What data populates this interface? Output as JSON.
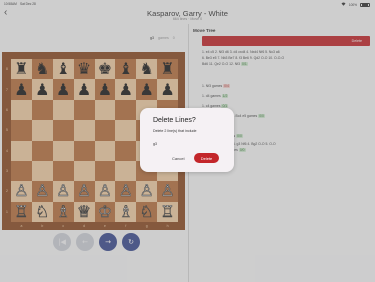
{
  "status_bar": {
    "time": "10:58AM",
    "date": "Sat Dec 28",
    "wifi": "wifi-icon",
    "battery_percent": "100%"
  },
  "header": {
    "title": "Kasparov, Garry - White",
    "subtitle": "664 lines · Move 0"
  },
  "left_toolbar": {
    "move": "g3",
    "games_label": "games",
    "games_count": "0"
  },
  "board": {
    "ranks": [
      "8",
      "7",
      "6",
      "5",
      "4",
      "3",
      "2",
      "1"
    ],
    "files": [
      "a",
      "b",
      "c",
      "d",
      "e",
      "f",
      "g",
      "h"
    ],
    "pieces": [
      [
        "♜",
        "♞",
        "♝",
        "♛",
        "♚",
        "♝",
        "♞",
        "♜"
      ],
      [
        "♟",
        "♟",
        "♟",
        "♟",
        "♟",
        "♟",
        "♟",
        "♟"
      ],
      [
        "",
        "",
        "",
        "",
        "",
        "",
        "",
        ""
      ],
      [
        "",
        "",
        "",
        "",
        "",
        "",
        "",
        ""
      ],
      [
        "",
        "",
        "",
        "",
        "",
        "",
        "",
        ""
      ],
      [
        "",
        "",
        "",
        "",
        "",
        "",
        "",
        ""
      ],
      [
        "♙",
        "♙",
        "♙",
        "♙",
        "♙",
        "♙",
        "♙",
        "♙"
      ],
      [
        "♖",
        "♘",
        "♗",
        "♕",
        "♔",
        "♗",
        "♘",
        "♖"
      ]
    ]
  },
  "nav": {
    "first": "|◀",
    "prev": "←",
    "next": "→",
    "flip": "↻"
  },
  "move_tree": {
    "title": "Move Tree",
    "selected_delete_label": "Delete",
    "lines": [
      {
        "text": "1. e4 c5 2. Nf3 d6 3. d4 cxd4 4. Nxd4 Nf6 5. Nc3 a6",
        "badge": "",
        "badge_class": "b"
      },
      {
        "text": "6. Be3 e5 7. Nb3 Be7 8. f3 Be6 9. Qd2 O-O 10. O-O-O",
        "badge": "",
        "badge_class": "b"
      },
      {
        "text": "Bd6 11. Qe2 O-O 12. Nf3",
        "badge": "0/1",
        "badge_class": "b"
      },
      {
        "text": "1. Nf3 games",
        "badge": "0/4",
        "badge_class": "r"
      },
      {
        "text": "1. d4 games",
        "badge": "1/2",
        "badge_class": "b"
      },
      {
        "text": "1. c4 games",
        "badge": "0/1",
        "badge_class": "b"
      },
      {
        "text": "1. c3 d5 2. e4 dxe4 3. Bc4 e5 games",
        "badge": "0/0",
        "badge_class": "b"
      },
      {
        "text": "1. e4 e5 games",
        "badge": "0/0",
        "badge_class": "b"
      },
      {
        "text": "1. d4 Nf6 2. c4 games",
        "badge": "0/0",
        "badge_class": "b"
      },
      {
        "text": "1. e4 Bg7 2. Nc3 c5 3. g3 Nf6 4. Bg2 O-O 5. O-O",
        "badge": "",
        "badge_class": "b"
      },
      {
        "text": "6. Nf3 d6 7. Nd5 games",
        "badge": "0/0",
        "badge_class": "b"
      },
      {
        "text": "1. d4 games",
        "badge": "0/0",
        "badge_class": "b"
      }
    ]
  },
  "dialog": {
    "title": "Delete Lines?",
    "message": "Delete 2 line(s) that include",
    "move": "g3",
    "cancel": "Cancel",
    "confirm": "Delete"
  }
}
